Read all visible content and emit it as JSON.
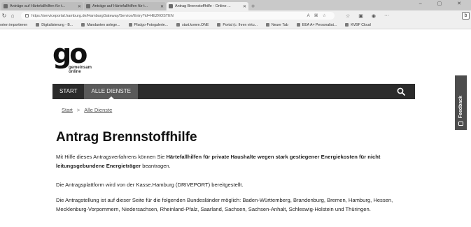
{
  "browser": {
    "tabs": [
      {
        "title": "Anträge auf Härtefallhilfen für t...",
        "active": false
      },
      {
        "title": "Anträge auf Härtefallhilfen für t...",
        "active": false
      },
      {
        "title": "Antrag Brennstoffhilfe - Online ...",
        "active": true
      }
    ],
    "new_tab": "+",
    "window_controls": "–  ▢  ✕",
    "url": "https://serviceportal.hamburg.de/HamburgGateway/Service/Entry?id=HEZKOSTEN",
    "favorites": [
      "orten importieren",
      "Digitalisierung - B...",
      "Mandanten anlege...",
      "Pfadgo-Fotogalerie...",
      "start.komm.ONE",
      "Portal (c: Ihren virtu...",
      "Neuer Tab",
      "EEA A+ Personaliat...",
      "KVBF Cloud"
    ],
    "profile_initial": "b"
  },
  "logo": {
    "word": "go",
    "line1": "gemeinsam",
    "line2": "online"
  },
  "nav": {
    "items": [
      {
        "label": "START",
        "active": false
      },
      {
        "label": "ALLE DIENSTE",
        "active": true
      }
    ]
  },
  "breadcrumb": {
    "start": "Start",
    "separator": ">",
    "current": "Alle Dienste"
  },
  "page": {
    "title": "Antrag Brennstoffhilfe",
    "p1_pre": "Mit Hilfe dieses Antragsverfahrens können Sie ",
    "p1_bold": "Härtefallhilfen für private Haushalte wegen stark gestiegener Energiekosten für nicht leitungsgebundene Energieträger",
    "p1_post": " beantragen.",
    "p2": "Die Antragsplattform wird von der Kasse.Hamburg (DRIVEPORT) bereitgestellt.",
    "p3": "Die Antragstellung ist auf dieser Seite für die folgenden Bundesländer möglich: Baden-Württemberg, Brandenburg, Bremen, Hamburg, Hessen, Mecklenburg-Vorpommern, Niedersachsen, Rheinland-Pfalz, Saarland, Sachsen, Sachsen-Anhalt, Schleswig-Holstein und Thüringen."
  },
  "feedback": {
    "label": "Feedback"
  }
}
